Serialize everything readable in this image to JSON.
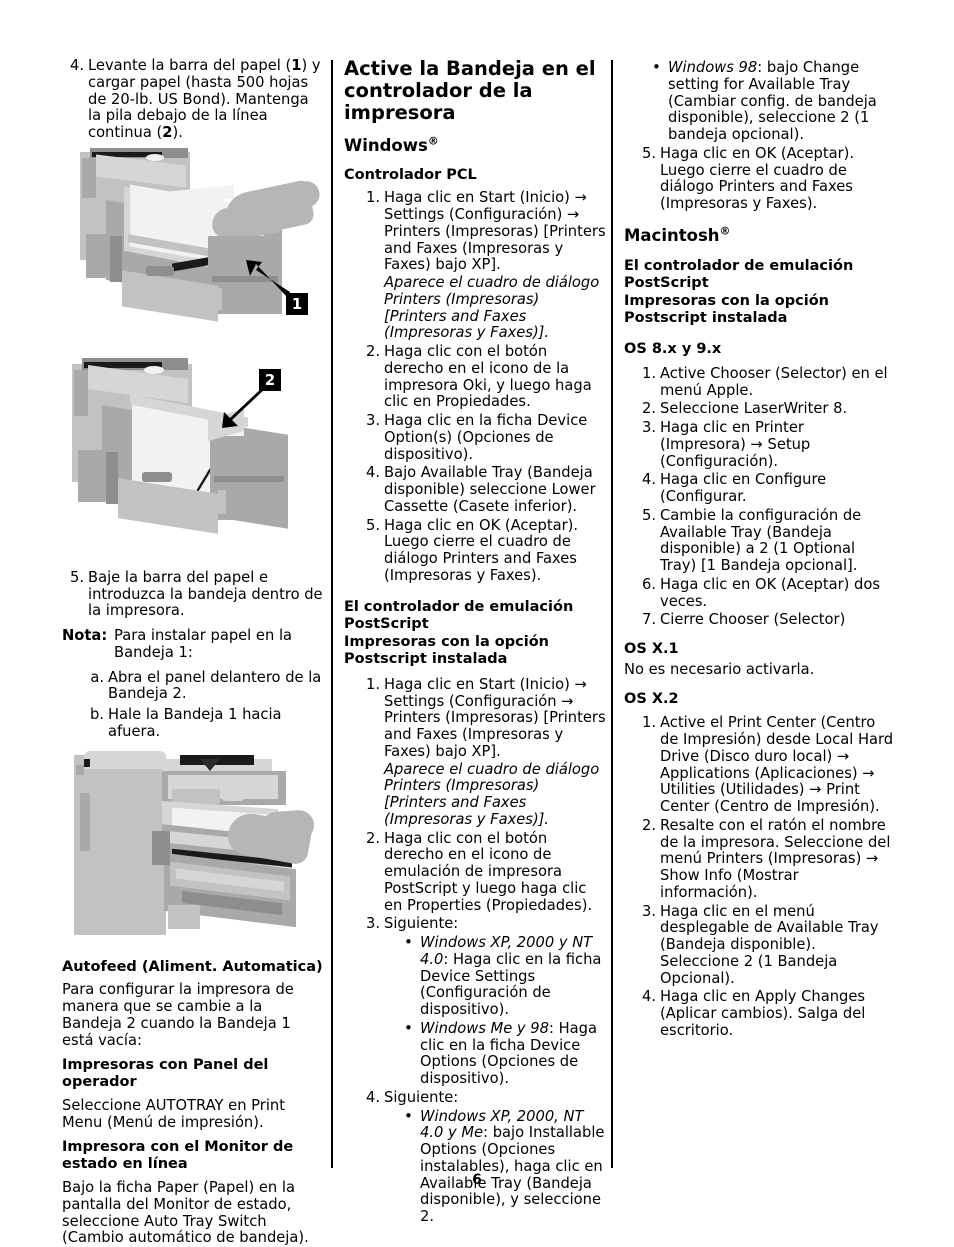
{
  "page": {
    "number": "6"
  },
  "left_column": {
    "step4": {
      "num": "4.",
      "text_a": "Levante la barra del papel (",
      "bold1": "1",
      "text_b": ") y cargar papel  (hasta 500 hojas de 20-lb. US Bond).  Mantenga la pila debajo de la línea continua (",
      "bold2": "2",
      "text_c": ")."
    },
    "figure1": {
      "alt": "Bandeja de papel abierta con la mano levantando la barra del papel",
      "callout": "1"
    },
    "figure2": {
      "alt": "Bandeja de papel cargada mostrando la línea continua de llenado",
      "callout": "2"
    },
    "step5": {
      "num": "5.",
      "text": "Baje la barra del papel e introduzca la bandeja dentro de la impresora."
    },
    "note": {
      "label": "Nota:",
      "text": "Para instalar papel en la Bandeja 1:"
    },
    "sub_steps": [
      {
        "num": "a.",
        "text": "Abra el panel delantero de la Bandeja 2."
      },
      {
        "num": "b.",
        "text": "Hale la Bandeja 1 hacia afuera."
      }
    ],
    "figure3": {
      "alt": "Impresora con el panel delantero abierto y la Bandeja 1 extraída"
    },
    "autofeed": {
      "heading": "Autofeed (Aliment. Automatica)",
      "intro": "Para configurar la impresora de manera que se cambie a la Bandeja 2 cuando la Bandeja 1 está vacía:",
      "sub1_heading": "Impresoras con Panel del operador",
      "sub1_text": "Seleccione AUTOTRAY en Print Menu (Menú de impresión).",
      "sub2_heading": "Impresora con el Monitor de estado en línea",
      "sub2_text": "Bajo la ficha Paper (Papel) en la pantalla del Monitor de estado, seleccione Auto Tray Switch (Cambio automático de bandeja)."
    }
  },
  "middle_column": {
    "title": "Active la Bandeja en el controlador de la impresora",
    "windows_heading": "Windows",
    "windows_reg": "®",
    "pcl_heading": "Controlador PCL",
    "pcl_steps": [
      {
        "num": "1.",
        "text": "Haga clic en Start (Inicio)  →  Settings (Configuración)  →  Printers (Impresoras) [Printers and Faxes (Impresoras y Faxes) bajo XP].",
        "italic": "Aparece el cuadro de diálogo Printers (Impresoras) [Printers and Faxes (Impresoras y Faxes)]."
      },
      {
        "num": "2.",
        "text": "Haga clic con el botón derecho en el icono de la impresora Oki, y luego haga clic en Propiedades."
      },
      {
        "num": "3.",
        "text": "Haga clic en la ficha Device Option(s) (Opciones de dispositivo)."
      },
      {
        "num": "4.",
        "text": "Bajo Available Tray (Bandeja disponible) seleccione Lower Cassette (Casete inferior)."
      },
      {
        "num": "5.",
        "text": "Haga clic en OK (Aceptar). Luego cierre el cuadro de diálogo Printers and Faxes (Impresoras y Faxes)."
      }
    ],
    "ps_heading_1": "El controlador de emulación PostScript",
    "ps_heading_2": "Impresoras con la opción Postscript instalada",
    "ps_steps": [
      {
        "num": "1.",
        "text": "Haga clic en Start (Inicio)  →  Settings (Configuración  →  Printers (Impresoras) [Printers and Faxes (Impresoras y Faxes) bajo XP].",
        "italic": "Aparece el cuadro de diálogo Printers (Impresoras) [Printers and Faxes (Impresoras y Faxes)]."
      },
      {
        "num": "2.",
        "text": "Haga clic con el botón derecho en el icono de emulación de impresora PostScript y luego haga clic en Properties (Propiedades)."
      },
      {
        "num": "3.",
        "text": "Siguiente:",
        "bullets": [
          {
            "italic": "Windows XP, 2000 y NT 4.0",
            "rest": ": Haga clic en la ficha Device Settings (Configuración de dispositivo)."
          },
          {
            "italic": "Windows Me y 98",
            "rest": ": Haga clic en la ficha Device Options (Opciones de dispositivo)."
          }
        ]
      },
      {
        "num": "4.",
        "text": "Siguiente:",
        "bullets": [
          {
            "italic": "Windows XP, 2000, NT 4.0 y Me",
            "rest": ": bajo Installable Options (Opciones instalables), haga clic en Available Tray (Bandeja disponible), y seleccione 2."
          }
        ]
      }
    ]
  },
  "right_column": {
    "continued_bullets": [
      {
        "italic": "Windows 98",
        "rest": ": bajo Change setting for Available Tray (Cambiar config. de bandeja disponible), seleccione 2 (1 bandeja opcional)."
      }
    ],
    "continued_step": {
      "num": "5.",
      "text": "Haga clic en OK (Aceptar). Luego cierre el cuadro de diálogo Printers and Faxes (Impresoras y Faxes)."
    },
    "macintosh_heading": "Macintosh",
    "macintosh_reg": "®",
    "ps_heading_1": "El controlador de emulación PostScript",
    "ps_heading_2": "Impresoras con la opción Postscript instalada",
    "os89_heading": "OS 8.x y 9.x",
    "os89_steps": [
      {
        "num": "1.",
        "text": "Active Chooser (Selector) en el menú Apple."
      },
      {
        "num": "2.",
        "text": "Seleccione LaserWriter 8."
      },
      {
        "num": "3.",
        "text": "Haga clic en Printer (Impresora)  →  Setup (Configuración)."
      },
      {
        "num": "4.",
        "text": "Haga clic en Configure (Configurar."
      },
      {
        "num": "5.",
        "text": "Cambie la configuración de Available Tray (Bandeja disponible) a 2 (1 Optional Tray) [1 Bandeja opcional]."
      },
      {
        "num": "6.",
        "text": "Haga clic en OK (Aceptar) dos veces."
      },
      {
        "num": "7.",
        "text": "Cierre Chooser (Selector)"
      }
    ],
    "osx1_heading": "OS X.1",
    "osx1_text": "No es necesario activarla.",
    "osx2_heading": "OS X.2",
    "osx2_steps": [
      {
        "num": "1.",
        "text": "Active el Print Center (Centro de Impresión) desde Local Hard Drive (Disco duro local)  →  Applications (Aplicaciones)  →  Utilities (Utilidades)  →  Print Center (Centro de Impresión)."
      },
      {
        "num": "2.",
        "text": "Resalte con el ratón el nombre de la impresora.  Seleccione del menú Printers (Impresoras)  →  Show Info (Mostrar información)."
      },
      {
        "num": "3.",
        "text": "Haga clic en el menú desplegable de Available Tray (Bandeja disponible). Seleccione 2 (1 Bandeja Opcional)."
      },
      {
        "num": "4.",
        "text": "Haga clic en Apply Changes (Aplicar cambios).   Salga del escritorio."
      }
    ]
  }
}
